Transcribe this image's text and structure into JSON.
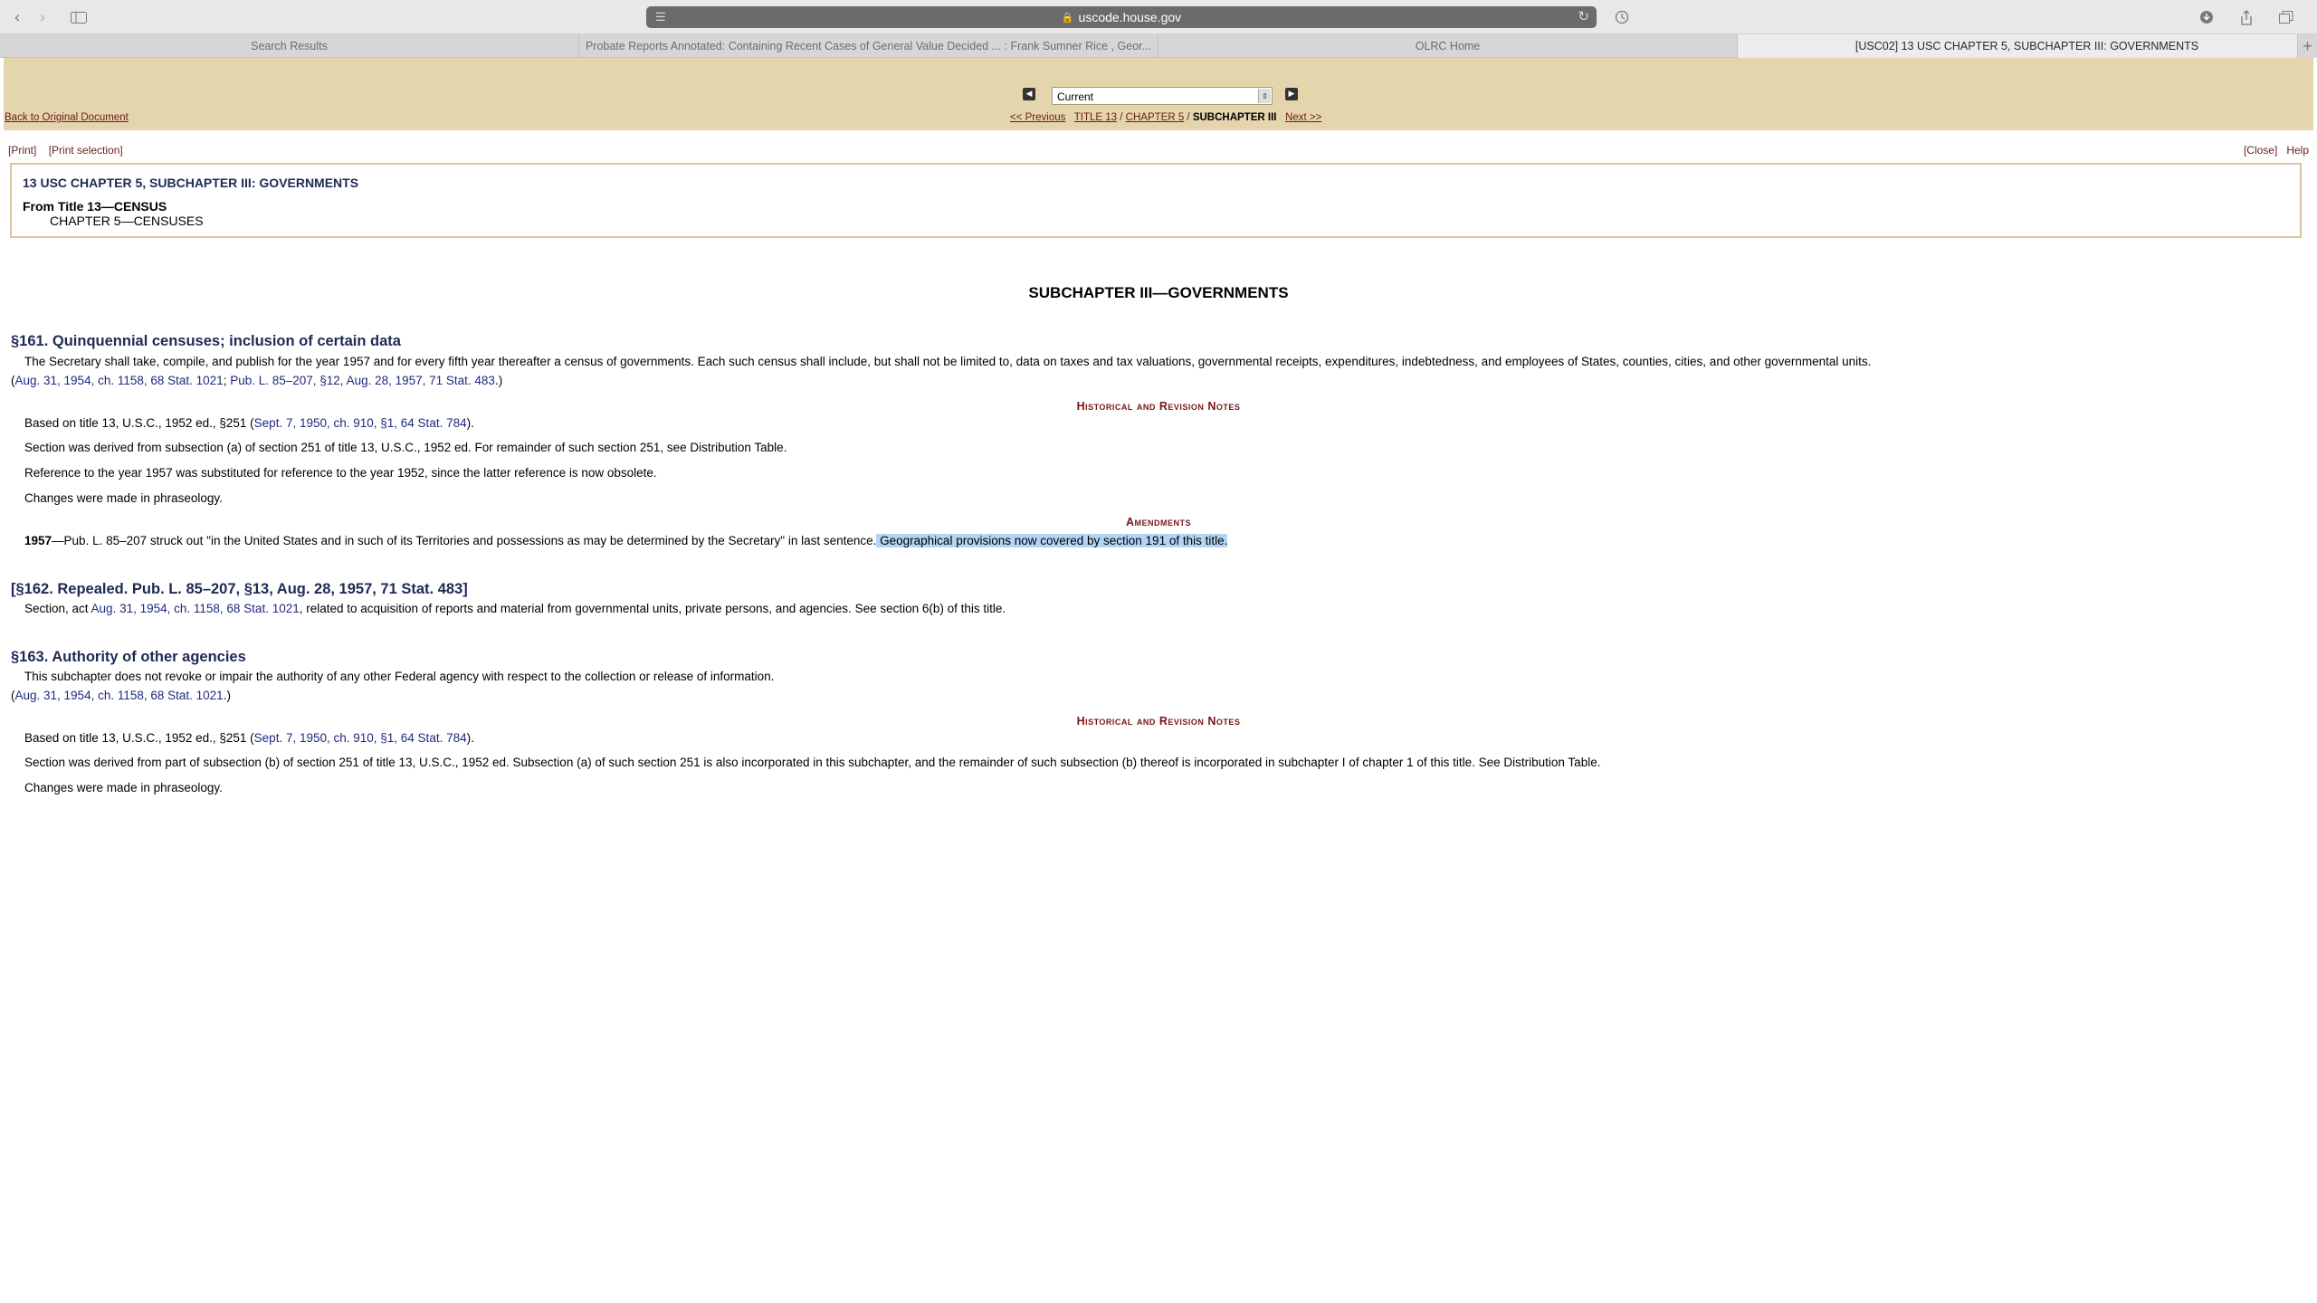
{
  "browser": {
    "url": "uscode.house.gov",
    "tabs": [
      {
        "label": "Search Results"
      },
      {
        "label": "Probate Reports Annotated: Containing Recent Cases of General Value Decided ... : Frank Sumner Rice , Geor..."
      },
      {
        "label": "OLRC Home"
      },
      {
        "label": "[USC02] 13 USC CHAPTER 5, SUBCHAPTER III: GOVERNMENTS"
      }
    ]
  },
  "nav": {
    "back_to_original": "Back to Original Document",
    "select_value": "Current",
    "previous": "<< Previous",
    "title": "TITLE 13",
    "sep1": " / ",
    "chapter": "CHAPTER 5",
    "sep2": " / ",
    "current": "SUBCHAPTER III",
    "next": "Next >>"
  },
  "printbar": {
    "print": "[Print]",
    "print_selection": "[Print selection]",
    "close": "[Close]",
    "help": "Help"
  },
  "infobox": {
    "heading": "13 USC CHAPTER 5, SUBCHAPTER III: GOVERNMENTS",
    "from_title": "From Title 13—CENSUS",
    "chapter": "CHAPTER 5—CENSUSES"
  },
  "content": {
    "subchapter_heading": "SUBCHAPTER III—GOVERNMENTS",
    "s161": {
      "heading": "§161. Quinquennial censuses; inclusion of certain data",
      "text": "The Secretary shall take, compile, and publish for the year 1957 and for every fifth year thereafter a census of governments. Each such census shall include, but shall not be limited to, data on taxes and tax valuations, governmental receipts, expenditures, indebtedness, and employees of States, counties, cities, and other governmental units.",
      "cite_open": "(",
      "cite_a": "Aug. 31, 1954, ch. 1158, 68 Stat. 1021",
      "cite_sep": "; ",
      "cite_b": "Pub. L. 85–207, §12, Aug. 28, 1957, 71 Stat. 483",
      "cite_close": ".)",
      "notes_heading": "Historical and Revision Notes",
      "note1_pre": "Based on title 13, U.S.C., 1952 ed., §251 (",
      "note1_link": "Sept. 7, 1950, ch. 910, §1, 64 Stat. 784",
      "note1_post": ").",
      "note2": "Section was derived from subsection (a) of section 251 of title 13, U.S.C., 1952 ed. For remainder of such section 251, see Distribution Table.",
      "note3": "Reference to the year 1957 was substituted for reference to the year 1952, since the latter reference is now obsolete.",
      "note4": "Changes were made in phraseology.",
      "amendments_heading": "Amendments",
      "amend_year": "1957",
      "amend_text": "—Pub. L. 85–207 struck out \"in the United States and in such of its Territories and possessions as may be determined by the Secretary\" in last sentence.",
      "amend_highlight": " Geographical provisions now covered by section 191 of this title."
    },
    "s162": {
      "heading": "[§162. Repealed. Pub. L. 85–207, §13, Aug. 28, 1957, 71 Stat. 483]",
      "text_pre": "Section, act ",
      "text_link": "Aug. 31, 1954, ch. 1158, 68 Stat. 1021",
      "text_post": ", related to acquisition of reports and material from governmental units, private persons, and agencies. See section 6(b) of this title."
    },
    "s163": {
      "heading": "§163. Authority of other agencies",
      "text": "This subchapter does not revoke or impair the authority of any other Federal agency with respect to the collection or release of information.",
      "cite_open": "(",
      "cite_a": "Aug. 31, 1954, ch. 1158, 68 Stat. 1021",
      "cite_close": ".)",
      "notes_heading": "Historical and Revision Notes",
      "note1_pre": "Based on title 13, U.S.C., 1952 ed., §251 (",
      "note1_link": "Sept. 7, 1950, ch. 910, §1, 64 Stat. 784",
      "note1_post": ").",
      "note2": "Section was derived from part of subsection (b) of section 251 of title 13, U.S.C., 1952 ed. Subsection (a) of such section 251 is also incorporated in this subchapter, and the remainder of such subsection (b) thereof is incorporated in subchapter I of chapter 1 of this title. See Distribution Table.",
      "note3": "Changes were made in phraseology."
    }
  }
}
